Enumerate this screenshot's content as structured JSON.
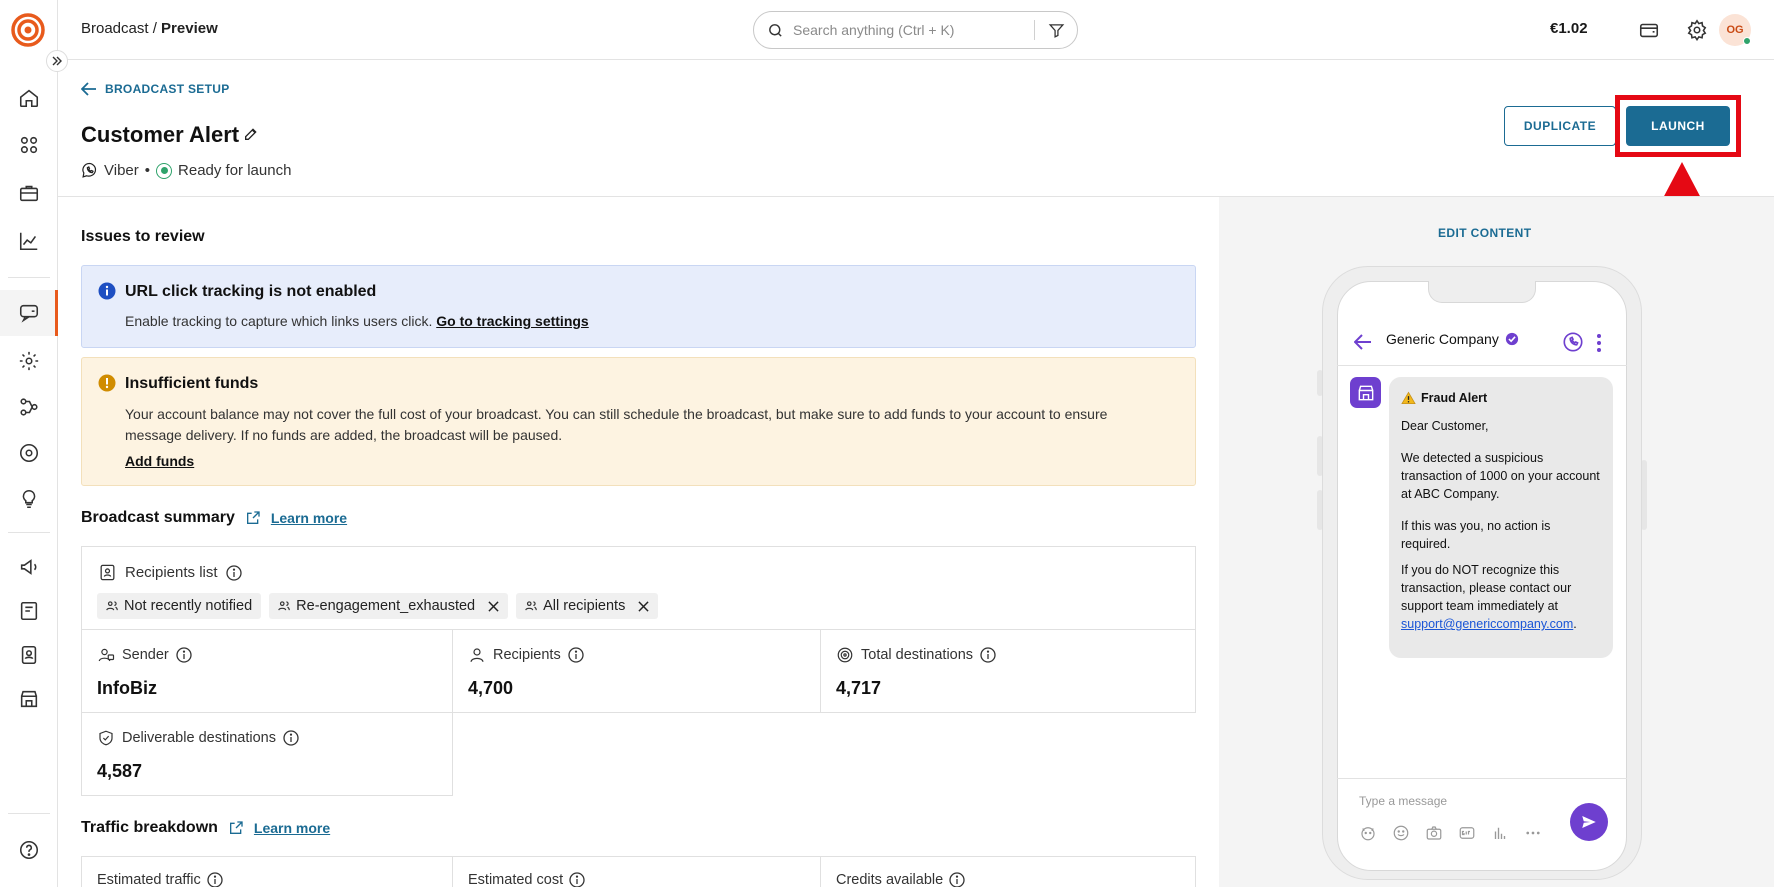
{
  "topbar": {
    "breadcrumb_parent": "Broadcast /",
    "breadcrumb_current": "Preview",
    "search_placeholder": "Search anything (Ctrl + K)",
    "balance": "€1.02",
    "avatar_initials": "OG"
  },
  "header": {
    "back_label": "BROADCAST SETUP",
    "title": "Customer Alert",
    "channel": "Viber",
    "separator": "•",
    "status": "Ready for launch",
    "duplicate_label": "DUPLICATE",
    "launch_label": "LAUNCH"
  },
  "issues": {
    "heading": "Issues to review",
    "tracking": {
      "title": "URL click tracking is not enabled",
      "text": "Enable tracking to capture which links users click.",
      "link": "Go to tracking settings"
    },
    "funds": {
      "title": "Insufficient funds",
      "text": "Your account balance may not cover the full cost of your broadcast. You can still schedule the broadcast, but make sure to add funds to your account to ensure message delivery. If no funds are added, the broadcast will be paused.",
      "link": "Add funds"
    }
  },
  "summary": {
    "heading": "Broadcast summary",
    "learn_more": "Learn more",
    "recipients_list_label": "Recipients list",
    "chips": [
      "Not recently notified",
      "Re-engagement_exhausted",
      "All recipients"
    ],
    "stats": [
      {
        "label": "Sender",
        "value": "InfoBiz"
      },
      {
        "label": "Recipients",
        "value": "4,700"
      },
      {
        "label": "Total destinations",
        "value": "4,717"
      },
      {
        "label": "Deliverable destinations",
        "value": "4,587"
      }
    ]
  },
  "traffic": {
    "heading": "Traffic breakdown",
    "learn_more": "Learn more",
    "cols": [
      "Estimated traffic",
      "Estimated cost",
      "Credits available"
    ]
  },
  "preview": {
    "edit_content": "EDIT CONTENT",
    "company": "Generic Company",
    "message": {
      "title": "Fraud Alert",
      "greeting": "Dear Customer,",
      "p1": "We detected a suspicious transaction of 1000 on your account at ABC Company.",
      "p2": "If this was you, no action is required.",
      "p3": "If you do NOT recognize this transaction, please contact our support team immediately at",
      "email": "support@genericcompany.com",
      "end": "."
    },
    "composer_placeholder": "Type a message"
  },
  "colors": {
    "accent": "#1b6b93",
    "brand": "#e85a1c",
    "highlight": "#e50914",
    "viber": "#6e3fcf"
  }
}
